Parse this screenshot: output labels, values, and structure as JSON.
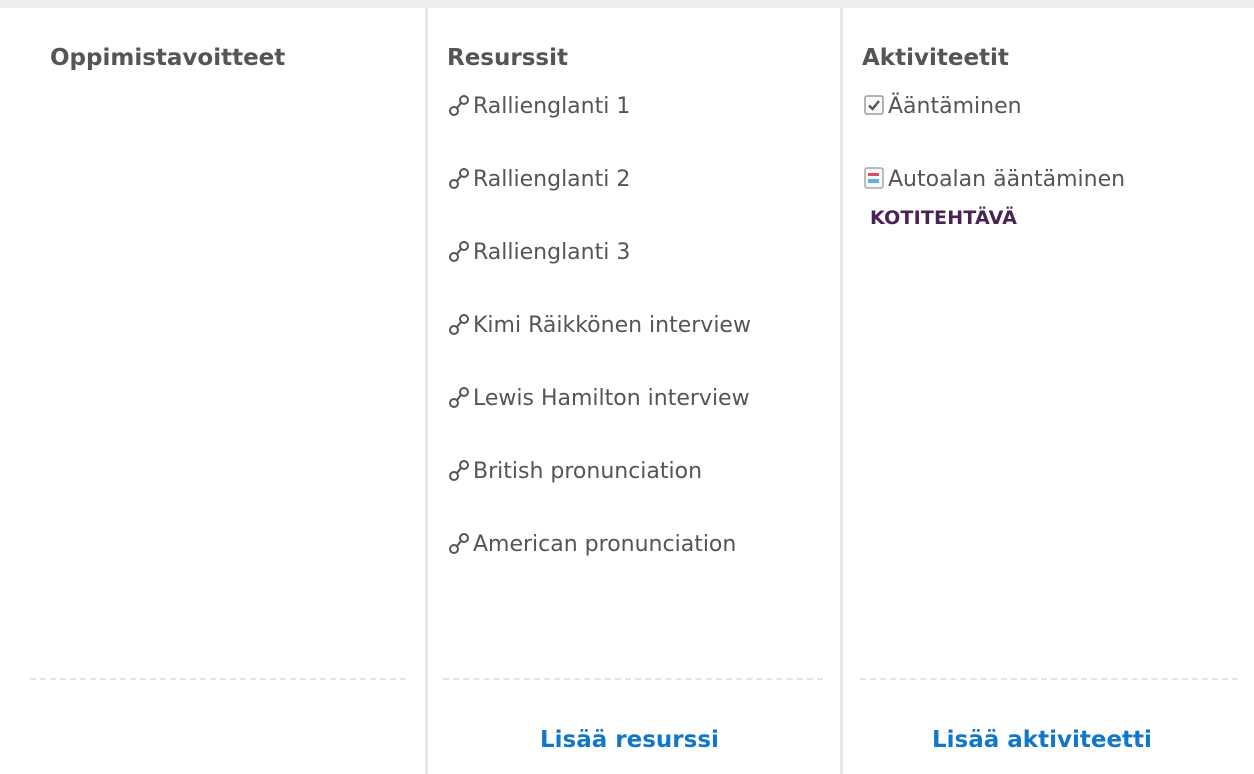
{
  "columns": {
    "objectives": {
      "title": "Oppimistavoitteet"
    },
    "resources": {
      "title": "Resurssit",
      "items": [
        {
          "label": "Rallienglanti 1",
          "icon": "link-icon"
        },
        {
          "label": "Rallienglanti 2",
          "icon": "link-icon"
        },
        {
          "label": "Rallienglanti 3",
          "icon": "link-icon"
        },
        {
          "label": "Kimi Räikkönen interview",
          "icon": "link-icon"
        },
        {
          "label": "Lewis Hamilton interview",
          "icon": "link-icon"
        },
        {
          "label": "British pronunciation",
          "icon": "link-icon"
        },
        {
          "label": "American pronunciation",
          "icon": "link-icon"
        }
      ],
      "add_label": "Lisää resurssi"
    },
    "activities": {
      "title": "Aktiviteetit",
      "items": [
        {
          "label": "Ääntäminen",
          "icon": "quiz-icon"
        },
        {
          "label": "Autoalan ääntäminen",
          "icon": "assignment-icon",
          "badge": "KOTITEHTÄVÄ"
        }
      ],
      "add_label": "Lisää aktiviteetti"
    }
  },
  "colors": {
    "text": "#555555",
    "link": "#1177c9",
    "badge": "#4a2355",
    "divider": "#e8e8e8"
  }
}
